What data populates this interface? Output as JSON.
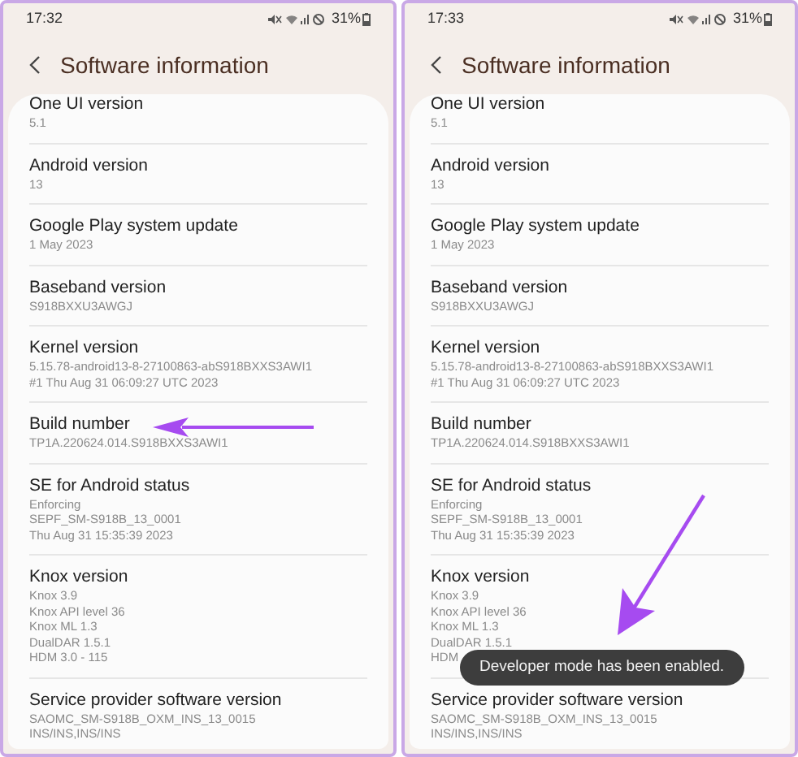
{
  "phones": [
    {
      "time": "17:32",
      "battery": "31%",
      "title": "Software information",
      "items": [
        {
          "label": "One UI version",
          "values": [
            "5.1"
          ]
        },
        {
          "label": "Android version",
          "values": [
            "13"
          ]
        },
        {
          "label": "Google Play system update",
          "values": [
            "1 May 2023"
          ]
        },
        {
          "label": "Baseband version",
          "values": [
            "S918BXXU3AWGJ"
          ]
        },
        {
          "label": "Kernel version",
          "values": [
            "5.15.78-android13-8-27100863-abS918BXXS3AWI1",
            "#1 Thu Aug 31 06:09:27 UTC 2023"
          ]
        },
        {
          "label": "Build number",
          "values": [
            "TP1A.220624.014.S918BXXS3AWI1"
          ]
        },
        {
          "label": "SE for Android status",
          "values": [
            "Enforcing",
            "SEPF_SM-S918B_13_0001",
            "Thu Aug 31 15:35:39 2023"
          ]
        },
        {
          "label": "Knox version",
          "values": [
            "Knox 3.9",
            "Knox API level 36",
            "Knox ML 1.3",
            "DualDAR 1.5.1",
            "HDM 3.0 - 115"
          ]
        },
        {
          "label": "Service provider software version",
          "values": [
            "SAOMC_SM-S918B_OXM_INS_13_0015",
            "INS/INS,INS/INS"
          ]
        }
      ]
    },
    {
      "time": "17:33",
      "battery": "31%",
      "title": "Software information",
      "toast": "Developer mode has been enabled.",
      "items": [
        {
          "label": "One UI version",
          "values": [
            "5.1"
          ]
        },
        {
          "label": "Android version",
          "values": [
            "13"
          ]
        },
        {
          "label": "Google Play system update",
          "values": [
            "1 May 2023"
          ]
        },
        {
          "label": "Baseband version",
          "values": [
            "S918BXXU3AWGJ"
          ]
        },
        {
          "label": "Kernel version",
          "values": [
            "5.15.78-android13-8-27100863-abS918BXXS3AWI1",
            "#1 Thu Aug 31 06:09:27 UTC 2023"
          ]
        },
        {
          "label": "Build number",
          "values": [
            "TP1A.220624.014.S918BXXS3AWI1"
          ]
        },
        {
          "label": "SE for Android status",
          "values": [
            "Enforcing",
            "SEPF_SM-S918B_13_0001",
            "Thu Aug 31 15:35:39 2023"
          ]
        },
        {
          "label": "Knox version",
          "values": [
            "Knox 3.9",
            "Knox API level 36",
            "Knox ML 1.3",
            "DualDAR 1.5.1",
            "HDM"
          ]
        },
        {
          "label": "Service provider software version",
          "values": [
            "SAOMC_SM-S918B_OXM_INS_13_0015",
            "INS/INS,INS/INS"
          ]
        }
      ]
    }
  ]
}
